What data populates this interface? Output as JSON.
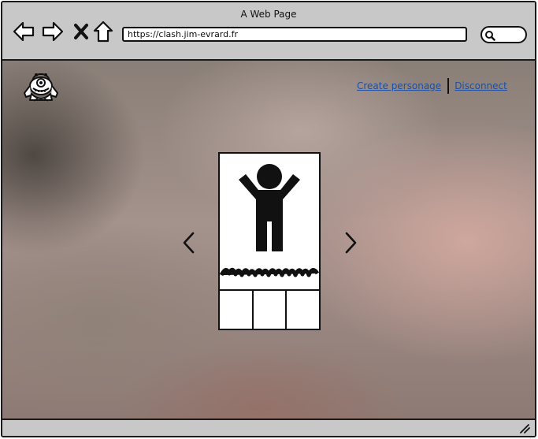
{
  "browser": {
    "window_title": "A Web Page",
    "url": "https://clash.jim-evrard.fr",
    "nav_icons": [
      "back-arrow-icon",
      "forward-arrow-icon",
      "close-x-icon",
      "home-icon"
    ],
    "search_icon": "magnifier-icon"
  },
  "header": {
    "logo_icon": "monster-logo-icon",
    "links": {
      "create": "Create personage",
      "disconnect": "Disconnect"
    },
    "link_color": "#1f4fa0"
  },
  "carousel": {
    "prev_icon": "chevron-left-icon",
    "next_icon": "chevron-right-icon",
    "card": {
      "figure_icon": "person-arms-raised-icon",
      "name_placeholder": "scribble-text",
      "stat_boxes": 3
    }
  },
  "statusbar": {
    "resize_icon": "resize-grip-icon"
  }
}
